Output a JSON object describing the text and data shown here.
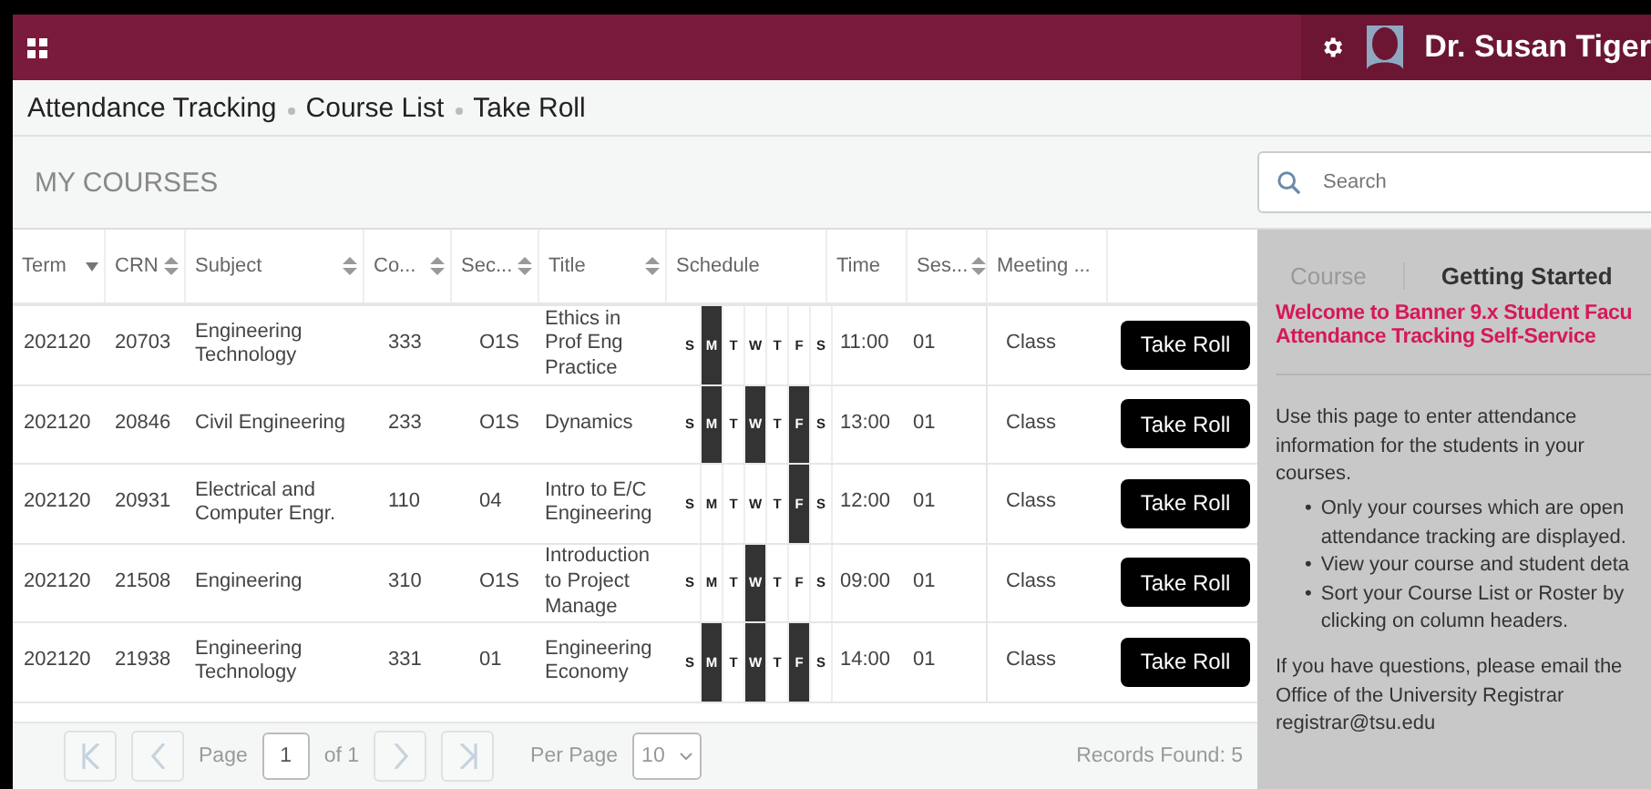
{
  "header": {
    "user_name": "Dr. Susan Tiger"
  },
  "breadcrumbs": [
    "Attendance Tracking",
    "Course List",
    "Take Roll"
  ],
  "section_title": "MY COURSES",
  "search": {
    "placeholder": "Search"
  },
  "table": {
    "columns": [
      {
        "label": "Term",
        "sortable": true,
        "sorted": true
      },
      {
        "label": "CRN",
        "sortable": true,
        "sorted": false
      },
      {
        "label": "Subject",
        "sortable": true,
        "sorted": false
      },
      {
        "label": "Co...",
        "sortable": true,
        "sorted": false
      },
      {
        "label": "Sec...",
        "sortable": true,
        "sorted": false
      },
      {
        "label": "Title",
        "sortable": true,
        "sorted": false
      },
      {
        "label": "Schedule",
        "sortable": false,
        "sorted": false
      },
      {
        "label": "Time",
        "sortable": false,
        "sorted": false
      },
      {
        "label": "Ses...",
        "sortable": true,
        "sorted": false
      },
      {
        "label": "Meeting ...",
        "sortable": false,
        "sorted": false
      }
    ],
    "rows": [
      {
        "term": "202120",
        "crn": "20703",
        "subject": "Engineering Technology",
        "course": "333",
        "section": "O1S",
        "title": "Ethics in Prof Eng Practice",
        "days": [
          {
            "label": "S",
            "selected": false
          },
          {
            "label": "M",
            "selected": true
          },
          {
            "label": "T",
            "selected": false
          },
          {
            "label": "W",
            "selected": false
          },
          {
            "label": "T",
            "selected": false
          },
          {
            "label": "F",
            "selected": false
          },
          {
            "label": "S",
            "selected": false
          }
        ],
        "time": "11:00",
        "session": "01",
        "meeting": "Class",
        "action": "Take Roll"
      },
      {
        "term": "202120",
        "crn": "20846",
        "subject": "Civil Engineering",
        "course": "233",
        "section": "O1S",
        "title": "Dynamics",
        "days": [
          {
            "label": "S",
            "selected": false
          },
          {
            "label": "M",
            "selected": true
          },
          {
            "label": "T",
            "selected": false
          },
          {
            "label": "W",
            "selected": true
          },
          {
            "label": "T",
            "selected": false
          },
          {
            "label": "F",
            "selected": true
          },
          {
            "label": "S",
            "selected": false
          }
        ],
        "time": "13:00",
        "session": "01",
        "meeting": "Class",
        "action": "Take Roll"
      },
      {
        "term": "202120",
        "crn": "20931",
        "subject": "Electrical and Computer Engr.",
        "course": "110",
        "section": "04",
        "title": "Intro to E/C Engineering",
        "days": [
          {
            "label": "S",
            "selected": false
          },
          {
            "label": "M",
            "selected": false
          },
          {
            "label": "T",
            "selected": false
          },
          {
            "label": "W",
            "selected": false
          },
          {
            "label": "T",
            "selected": false
          },
          {
            "label": "F",
            "selected": true
          },
          {
            "label": "S",
            "selected": false
          }
        ],
        "time": "12:00",
        "session": "01",
        "meeting": "Class",
        "action": "Take Roll"
      },
      {
        "term": "202120",
        "crn": "21508",
        "subject": "Engineering",
        "course": "310",
        "section": "O1S",
        "title": "Introduction to Project Manage",
        "days": [
          {
            "label": "S",
            "selected": false
          },
          {
            "label": "M",
            "selected": false
          },
          {
            "label": "T",
            "selected": false
          },
          {
            "label": "W",
            "selected": true
          },
          {
            "label": "T",
            "selected": false
          },
          {
            "label": "F",
            "selected": false
          },
          {
            "label": "S",
            "selected": false
          }
        ],
        "time": "09:00",
        "session": "01",
        "meeting": "Class",
        "action": "Take Roll"
      },
      {
        "term": "202120",
        "crn": "21938",
        "subject": "Engineering Technology",
        "course": "331",
        "section": "01",
        "title": "Engineering Economy",
        "days": [
          {
            "label": "S",
            "selected": false
          },
          {
            "label": "M",
            "selected": true
          },
          {
            "label": "T",
            "selected": false
          },
          {
            "label": "W",
            "selected": true
          },
          {
            "label": "T",
            "selected": false
          },
          {
            "label": "F",
            "selected": true
          },
          {
            "label": "S",
            "selected": false
          }
        ],
        "time": "14:00",
        "session": "01",
        "meeting": "Class",
        "action": "Take Roll"
      }
    ]
  },
  "pagination": {
    "page_label": "Page",
    "page": "1",
    "of_label": "of 1",
    "per_page_label": "Per Page",
    "per_page": "10",
    "records": "Records Found: 5"
  },
  "side_panel": {
    "tabs": [
      {
        "label": "Course",
        "selected": false
      },
      {
        "label": "Getting Started",
        "selected": true
      }
    ],
    "welcome_lines": [
      "Welcome to Banner 9.x Student Facu",
      "Attendance Tracking Self-Service"
    ],
    "intro": "Use this page to enter attendance information for the students in your courses.",
    "bullets": [
      {
        "marker": "•",
        "lines": [
          "Only your courses which are open",
          "attendance tracking are displayed."
        ]
      },
      {
        "marker": "•",
        "lines": [
          "View your course and student deta"
        ]
      },
      {
        "marker": "•",
        "lines": [
          "Sort your Course List or Roster by",
          "clicking on column headers."
        ]
      }
    ],
    "contact_lines": [
      "If you have questions, please email the",
      "Office of the University Registrar",
      "registrar@tsu.edu"
    ]
  }
}
